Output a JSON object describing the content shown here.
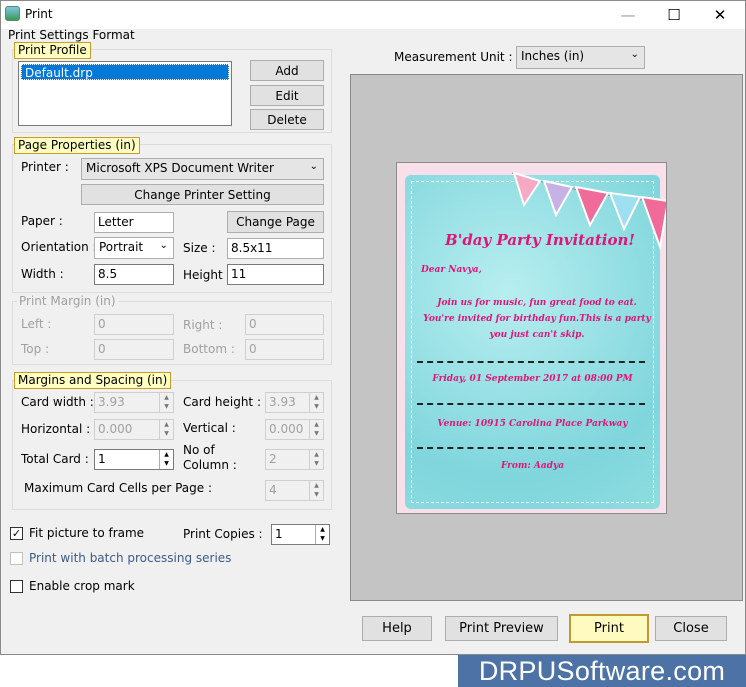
{
  "window": {
    "title": "Print",
    "controls": {
      "minimize": "—",
      "maximize": "☐",
      "close": "✕"
    }
  },
  "print_settings_format_label": "Print Settings Format",
  "print_profile": {
    "legend": "Print Profile",
    "profiles": [
      "Default.drp"
    ],
    "selected": "Default.drp",
    "buttons": {
      "add": "Add",
      "edit": "Edit",
      "delete": "Delete"
    }
  },
  "page_properties": {
    "legend": "Page Properties  (in)",
    "printer_label": "Printer :",
    "printer_value": "Microsoft XPS Document Writer",
    "change_printer_button": "Change Printer Setting",
    "paper_label": "Paper :",
    "paper_value": "Letter",
    "change_page_button": "Change Page",
    "orientation_label": "Orientation :",
    "orientation_value": "Portrait",
    "size_label": "Size :",
    "size_value": "8.5x11",
    "width_label": "Width :",
    "width_value": "8.5",
    "height_label": "Height :",
    "height_value": "11"
  },
  "print_margin": {
    "legend": "Print Margin (in)",
    "left_label": "Left :",
    "left_value": "0",
    "right_label": "Right :",
    "right_value": "0",
    "top_label": "Top :",
    "top_value": "0",
    "bottom_label": "Bottom :",
    "bottom_value": "0"
  },
  "margins_spacing": {
    "legend": "Margins and Spacing  (in)",
    "card_width_label": "Card width :",
    "card_width_value": "3.93",
    "card_height_label": "Card height :",
    "card_height_value": "3.93",
    "horizontal_label": "Horizontal :",
    "horizontal_value": "0.000",
    "vertical_label": "Vertical :",
    "vertical_value": "0.000",
    "total_card_label": "Total Card :",
    "total_card_value": "1",
    "no_of_column_label": "No of\nColumn :",
    "no_of_column_line1": "No of",
    "no_of_column_line2": "Column :",
    "no_of_column_value": "2",
    "max_cells_label": "Maximum Card Cells per Page :",
    "max_cells_value": "4"
  },
  "options": {
    "fit_picture_label": "Fit picture to frame",
    "fit_picture_checked": true,
    "print_copies_label": "Print Copies :",
    "print_copies_value": "1",
    "batch_label": "Print with batch processing series",
    "batch_checked": false,
    "crop_mark_label": "Enable crop mark",
    "crop_mark_checked": false
  },
  "measurement": {
    "label": "Measurement Unit :",
    "value": "Inches (in)"
  },
  "card_preview": {
    "heading": "B'day Party Invitation!",
    "greeting": "Dear Navya,",
    "body": "Join us for music, fun great food to eat. You're invited for birthday fun.This is a party you just can't skip.",
    "date": "Friday, 01 September 2017 at 08:00 PM",
    "venue": "Venue: 10915 Carolina Place Parkway",
    "from": "From: Aadya",
    "colors": {
      "text": "#e0157a",
      "background": "#8edde0"
    }
  },
  "footer_buttons": {
    "help": "Help",
    "print_preview": "Print Preview",
    "print": "Print",
    "close": "Close"
  },
  "brand": "DRPUSoftware.com"
}
